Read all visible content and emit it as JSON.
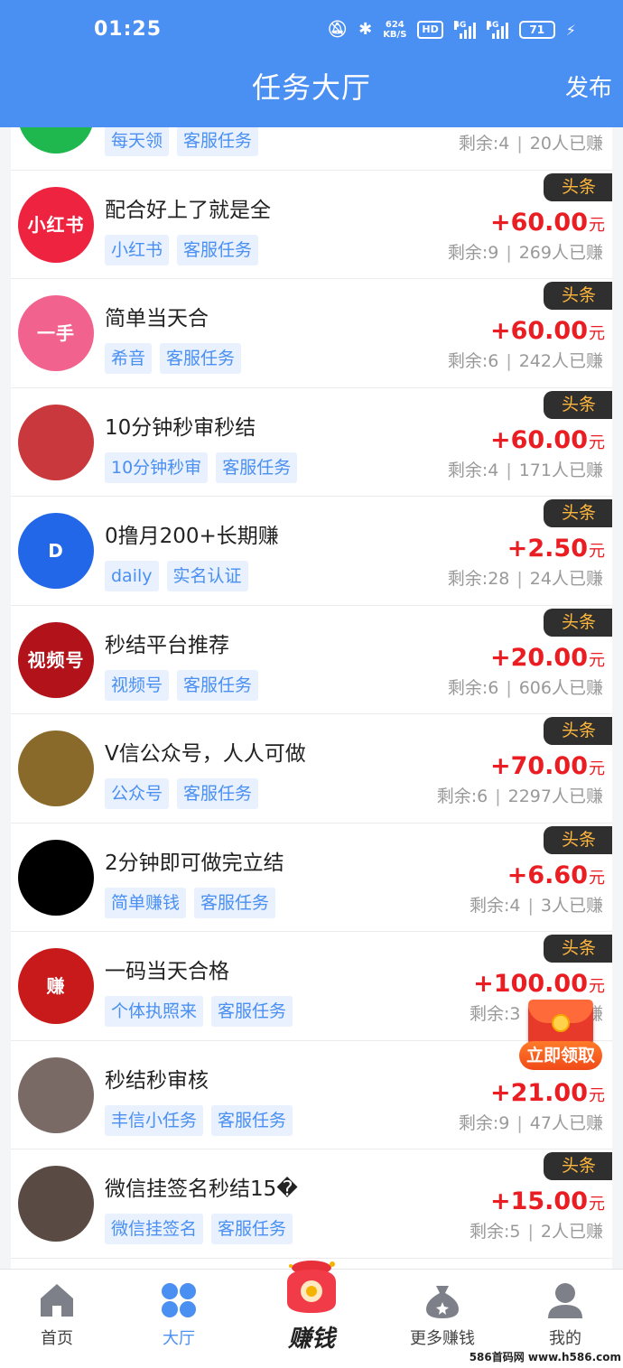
{
  "status_bar": {
    "time": "01:25",
    "net_speed_value": "624",
    "net_speed_unit": "KB/S",
    "hd_label": "HD",
    "signal_label": "4G",
    "battery": "71"
  },
  "header": {
    "title": "任务大厅",
    "publish_label": "发布"
  },
  "remaining_prefix": "剩余:",
  "earned_suffix": "人已赚",
  "price_unit": "元",
  "tasks": [
    {
      "title": "",
      "tags": [
        "每天领",
        "客服任务"
      ],
      "badge": "",
      "price": "",
      "remaining": "4",
      "earned": "20",
      "avatar_text": "",
      "avatar_color": "#1fb84f"
    },
    {
      "title": "配合好上了就是全",
      "tags": [
        "小红书",
        "客服任务"
      ],
      "badge": "头条",
      "price": "+60.00",
      "remaining": "9",
      "earned": "269",
      "avatar_text": "小红书",
      "avatar_color": "#ee2340"
    },
    {
      "title": "简单当天合",
      "tags": [
        "希音",
        "客服任务"
      ],
      "badge": "头条",
      "price": "+60.00",
      "remaining": "6",
      "earned": "242",
      "avatar_text": "一手",
      "avatar_color": "#f2628e"
    },
    {
      "title": "10分钟秒审秒结",
      "tags": [
        "10分钟秒审",
        "客服任务"
      ],
      "badge": "头条",
      "price": "+60.00",
      "remaining": "4",
      "earned": "171",
      "avatar_text": "",
      "avatar_color": "#c8383c"
    },
    {
      "title": "0撸月200+长期赚",
      "tags": [
        "daily",
        "实名认证"
      ],
      "badge": "头条",
      "price": "+2.50",
      "remaining": "28",
      "earned": "24",
      "avatar_text": "D",
      "avatar_color": "#2167e8"
    },
    {
      "title": "秒结平台推荐",
      "tags": [
        "视频号",
        "客服任务"
      ],
      "badge": "头条",
      "price": "+20.00",
      "remaining": "6",
      "earned": "606",
      "avatar_text": "视频号",
      "avatar_color": "#b2121a"
    },
    {
      "title": "V信公众号，人人可做",
      "tags": [
        "公众号",
        "客服任务"
      ],
      "badge": "头条",
      "price": "+70.00",
      "remaining": "6",
      "earned": "2297",
      "avatar_text": "",
      "avatar_color": "#8a6a2a"
    },
    {
      "title": "2分钟即可做完立结",
      "tags": [
        "简单赚钱",
        "客服任务"
      ],
      "badge": "头条",
      "price": "+6.60",
      "remaining": "4",
      "earned": "3",
      "avatar_text": "",
      "avatar_color": "#000000"
    },
    {
      "title": "一码当天合格",
      "tags": [
        "个体执照来",
        "客服任务"
      ],
      "badge": "头条",
      "price": "+100.00",
      "remaining": "3",
      "earned": "3",
      "avatar_text": "赚",
      "avatar_color": "#c81a1a"
    },
    {
      "title": "秒结秒审核",
      "tags": [
        "丰信小任务",
        "客服任务"
      ],
      "badge": "",
      "price": "+21.00",
      "remaining": "9",
      "earned": "47",
      "avatar_text": "",
      "avatar_color": "#7a6a66"
    },
    {
      "title": "微信挂签名秒结15�",
      "tags": [
        "微信挂签名",
        "客服任务"
      ],
      "badge": "头条",
      "price": "+15.00",
      "remaining": "5",
      "earned": "2",
      "avatar_text": "",
      "avatar_color": "#5a4a44"
    }
  ],
  "floating_promo": {
    "label": "立即领取"
  },
  "tabbar": {
    "home": "首页",
    "hall": "大厅",
    "earn": "赚钱",
    "more": "更多赚钱",
    "mine": "我的"
  },
  "watermark": "586首码网 www.h586.com"
}
